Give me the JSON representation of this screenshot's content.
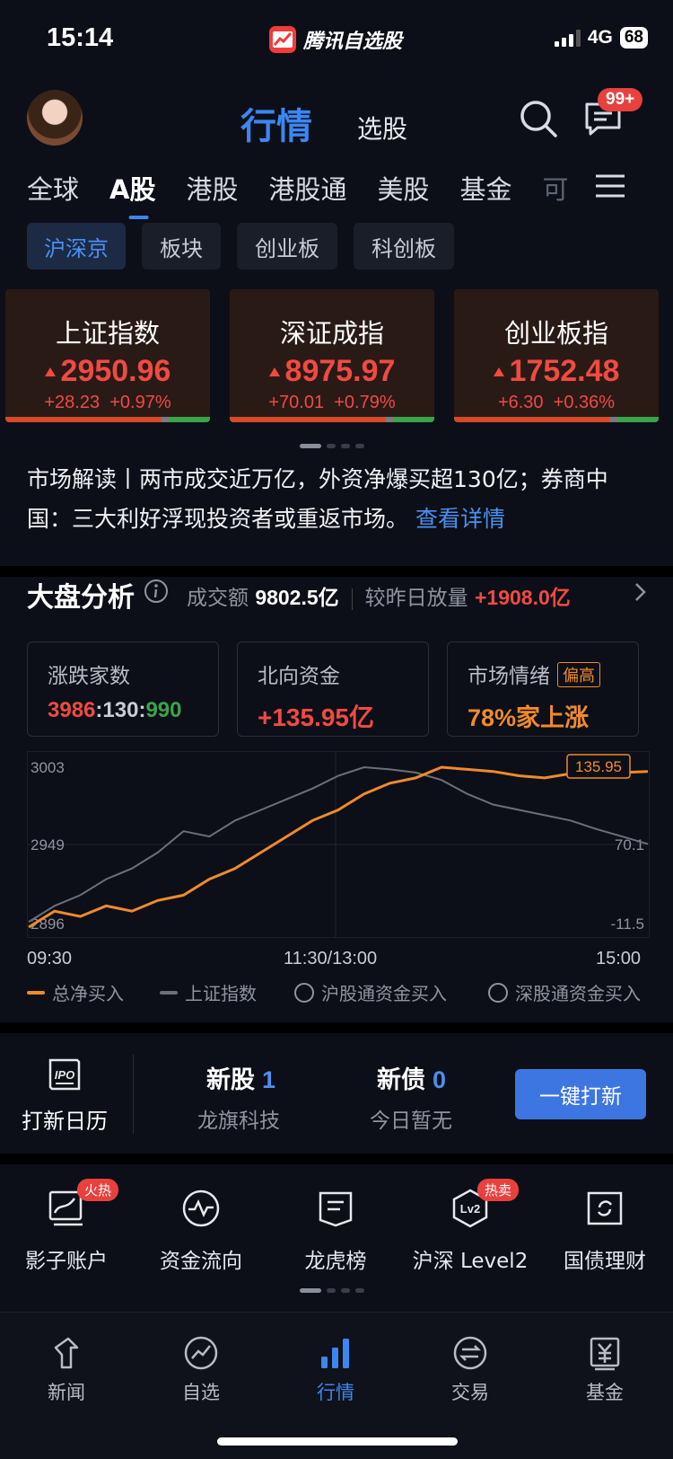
{
  "status": {
    "time": "15:14",
    "app": "腾讯自选股",
    "network": "4G",
    "battery": "68"
  },
  "header": {
    "tab_quote": "行情",
    "tab_pick": "选股",
    "msg_badge": "99+"
  },
  "market_tabs": [
    "全球",
    "A股",
    "港股",
    "港股通",
    "美股",
    "基金",
    "可"
  ],
  "segments": [
    "沪深京",
    "板块",
    "创业板",
    "科创板"
  ],
  "indices": [
    {
      "name": "上证指数",
      "value": "2950.96",
      "change": "+28.23",
      "pct": "+0.97%"
    },
    {
      "name": "深证成指",
      "value": "8975.97",
      "change": "+70.01",
      "pct": "+0.79%"
    },
    {
      "name": "创业板指",
      "value": "1752.48",
      "change": "+6.30",
      "pct": "+0.36%"
    }
  ],
  "news": {
    "text": "市场解读丨两市成交近万亿，外资净爆买超130亿；券商中国：三大利好浮现投资者或重返市场。",
    "link": "查看详情"
  },
  "analysis": {
    "title": "大盘分析",
    "turnover_label": "成交额",
    "turnover_value": "9802.5亿",
    "vol_label": "较昨日放量",
    "vol_value": "+1908.0亿",
    "breadth_label": "涨跌家数",
    "breadth_up": "3986",
    "breadth_flat": "130",
    "breadth_down": "990",
    "north_label": "北向资金",
    "north_value": "+135.95亿",
    "mood_label": "市场情绪",
    "mood_tag": "偏高",
    "mood_value": "78%家上涨"
  },
  "chart_data": {
    "type": "line",
    "x_ticks": [
      "09:30",
      "11:30/13:00",
      "15:00"
    ],
    "y_left_ticks": [
      "3003",
      "2949",
      "2896"
    ],
    "y_right_ticks": [
      "70.1",
      "-11.5"
    ],
    "end_label": "135.95",
    "series": [
      {
        "name": "总净买入",
        "color": "#f08a2c",
        "values": [
          -10,
          5,
          0,
          10,
          5,
          15,
          20,
          35,
          45,
          60,
          75,
          90,
          100,
          115,
          125,
          130,
          140,
          138,
          136,
          132,
          130,
          134,
          138,
          135,
          136
        ]
      },
      {
        "name": "上证指数",
        "color": "#6b6f7a",
        "values": [
          -5,
          10,
          20,
          35,
          45,
          60,
          80,
          75,
          90,
          100,
          110,
          120,
          132,
          140,
          138,
          135,
          128,
          115,
          105,
          100,
          95,
          90,
          82,
          75,
          68
        ]
      }
    ],
    "legend": [
      "总净买入",
      "上证指数",
      "沪股通资金买入",
      "深股通资金买入"
    ]
  },
  "ipo": {
    "calendar_label": "打新日历",
    "stock_label": "新股",
    "stock_count": "1",
    "stock_sub": "龙旗科技",
    "bond_label": "新债",
    "bond_count": "0",
    "bond_sub": "今日暂无",
    "button": "一键打新"
  },
  "tools": [
    {
      "label": "影子账户",
      "badge": "火热"
    },
    {
      "label": "资金流向",
      "badge": ""
    },
    {
      "label": "龙虎榜",
      "badge": ""
    },
    {
      "label": "沪深 Level2",
      "badge": "热卖"
    },
    {
      "label": "国债理财",
      "badge": ""
    }
  ],
  "nav": [
    "新闻",
    "自选",
    "行情",
    "交易",
    "基金"
  ],
  "colors": {
    "accent": "#3d86f0",
    "up": "#f04a43",
    "down": "#3aa34a",
    "orange": "#f08a2c"
  }
}
